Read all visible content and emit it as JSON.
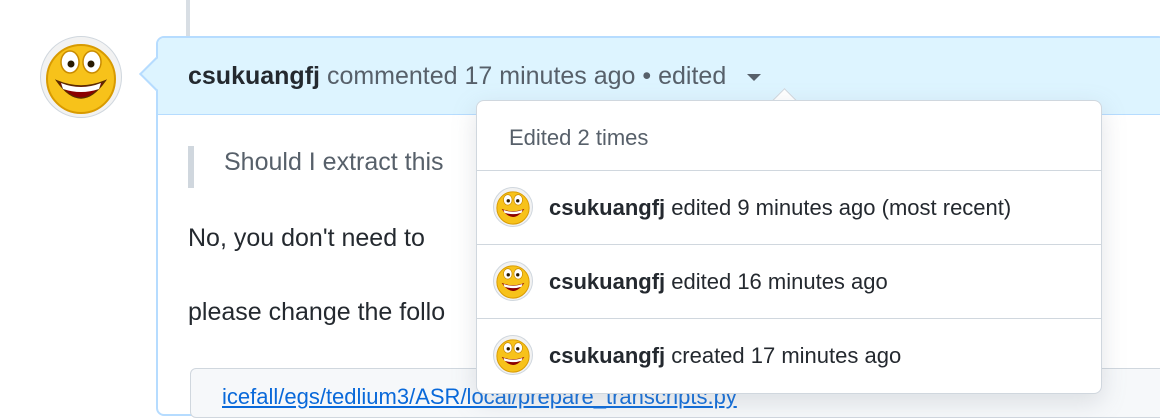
{
  "comment": {
    "author": "csukuangfj",
    "action": "commented 17 minutes ago",
    "separator": "•",
    "edited_label": "edited",
    "quote": "Should I extract this",
    "paragraph1": "No, you don't need to",
    "paragraph2": "please change the follo",
    "code_file": "icefall/egs/tedlium3/ASR/local/prepare_transcripts.py"
  },
  "edit_history": {
    "title": "Edited 2 times",
    "entries": [
      {
        "author": "csukuangfj",
        "description": "edited 9 minutes ago (most recent)"
      },
      {
        "author": "csukuangfj",
        "description": "edited 16 minutes ago"
      },
      {
        "author": "csukuangfj",
        "description": "created 17 minutes ago"
      }
    ]
  },
  "colors": {
    "header_bg": "#ddf4ff",
    "header_border": "#b6dcff",
    "link": "#0969da",
    "muted": "#57606a"
  },
  "icons": {
    "avatar": "grinning-face-avatar",
    "caret": "triangle-down-icon"
  }
}
